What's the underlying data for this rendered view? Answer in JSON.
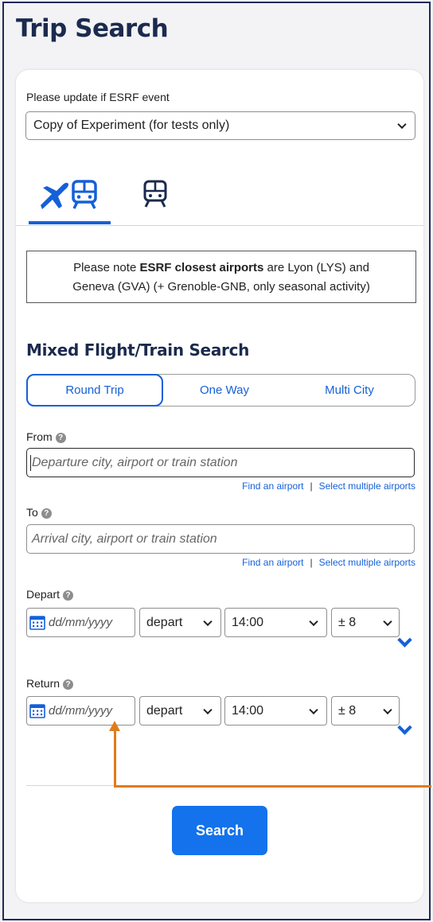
{
  "page": {
    "title": "Trip Search"
  },
  "event": {
    "label": "Please update if ESRF event",
    "selected": "Copy of Experiment (for tests only)"
  },
  "mode_tabs": [
    {
      "name": "flight-train",
      "icon": "plane-train-icon",
      "active": true
    },
    {
      "name": "train",
      "icon": "train-icon",
      "active": false
    }
  ],
  "notice": {
    "prefix": "Please note ",
    "bold": "ESRF closest airports",
    "line1_rest": " are Lyon (LYS) and",
    "line2": "Geneva (GVA) (+ Grenoble-GNB, only seasonal activity)"
  },
  "search": {
    "title": "Mixed Flight/Train Search",
    "trip_types": [
      "Round Trip",
      "One Way",
      "Multi City"
    ],
    "from": {
      "label": "From",
      "placeholder": "Departure city, airport or train station",
      "link1": "Find an airport",
      "separator": "|",
      "link2": "Select multiple airports"
    },
    "to": {
      "label": "To",
      "placeholder": "Arrival city, airport or train station",
      "link1": "Find an airport",
      "separator": "|",
      "link2": "Select multiple airports"
    },
    "depart": {
      "label": "Depart",
      "date_placeholder": "dd/mm/yyyy",
      "mode": "depart",
      "time": "14:00",
      "window": "± 8"
    },
    "return": {
      "label": "Return",
      "date_placeholder": "dd/mm/yyyy",
      "mode": "depart",
      "time": "14:00",
      "window": "± 8"
    },
    "submit_label": "Search"
  },
  "colors": {
    "accent": "#1560d8",
    "button": "#1372ec",
    "title": "#1b2a4e",
    "annotation_arrow": "#e07b1a"
  }
}
